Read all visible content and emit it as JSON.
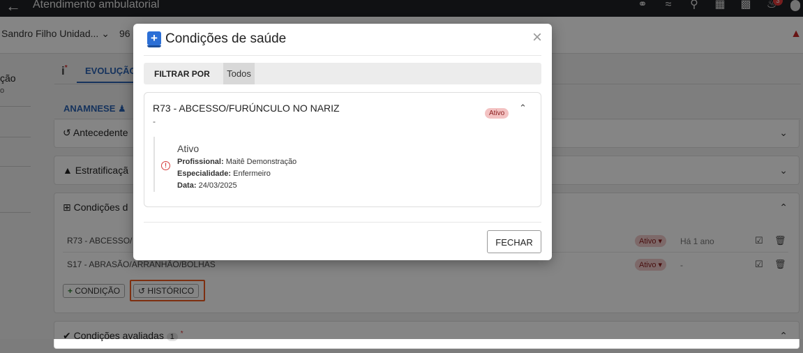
{
  "app": {
    "title": "Atendimento ambulatorial",
    "back_icon": "arrow-left-icon",
    "notifications_count": "3"
  },
  "subbar": {
    "unit": "Sandro Filho Unidad...",
    "number": "96"
  },
  "leftnav": {
    "item_label": "ção",
    "item_sub": "o"
  },
  "tabs": {
    "info_label": "i",
    "info_star": "*",
    "evolucao": "EVOLUÇÃO"
  },
  "section": {
    "anamnese": "ANAMNESE"
  },
  "cards": {
    "antecedentes": "Antecedente",
    "estratificacao": "Estratificaçã",
    "condicoes": "Condições d",
    "condicoes_avaliadas": "Condições avaliadas",
    "condicoes_avaliadas_count": "1",
    "required_star": "*"
  },
  "conditions_list": [
    {
      "name": "R73 - ABCESSO/",
      "status": "Ativo",
      "since": "Há 1 ano"
    },
    {
      "name": "S17 - ABRASÃO/ARRANHÃO/BOLHAS",
      "status": "Ativo",
      "since": "-"
    }
  ],
  "buttons": {
    "add_condition": "CONDIÇÃO",
    "history": "HISTÓRICO"
  },
  "modal": {
    "title": "Condições de saúde",
    "filter_label": "FILTRAR POR",
    "filter_value": "Todos",
    "close_label": "FECHAR",
    "condition": {
      "title": "R73 - ABCESSO/FURÚNCULO NO NARIZ",
      "subtitle": "-",
      "badge": "Ativo",
      "entry": {
        "status": "Ativo",
        "profissional_label": "Profissional:",
        "profissional": "Maitê Demonstração",
        "especialidade_label": "Especialidade:",
        "especialidade": "Enfermeiro",
        "data_label": "Data:",
        "data": "24/03/2025"
      }
    }
  },
  "colors": {
    "accent": "#2b63b3",
    "highlight": "#ef5a1f",
    "badge_bg": "#f3c2c2",
    "alert": "#d63b3b"
  }
}
